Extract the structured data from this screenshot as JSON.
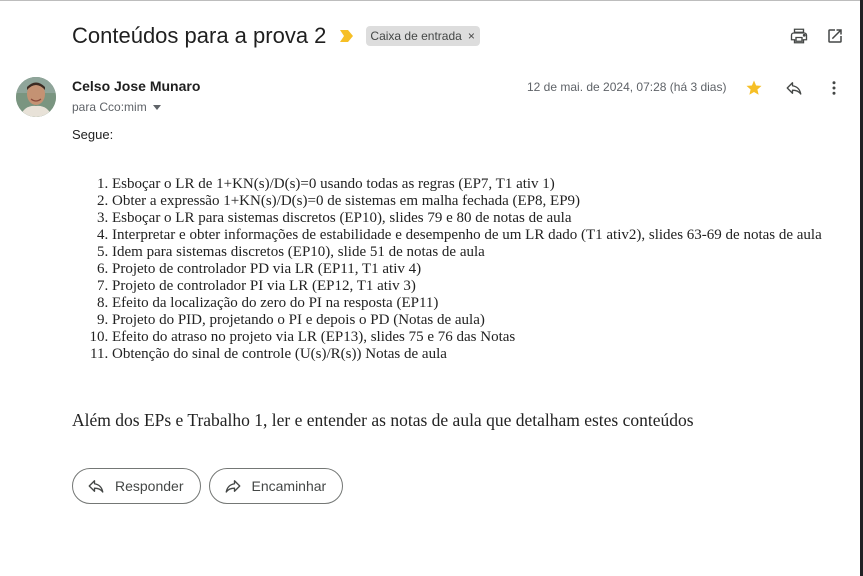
{
  "subject": "Conteúdos para a prova 2",
  "label": {
    "text": "Caixa de entrada",
    "remove": "×"
  },
  "toolbar": {
    "print_icon": "print-icon",
    "open_new_window_icon": "open-in-new-window-icon"
  },
  "sender": {
    "name": "Celso Jose Munaro",
    "recipient": "para Cco:mim",
    "date": "12 de mai. de 2024, 07:28 (há 3 dias)",
    "starred": true
  },
  "body": {
    "greeting": "Segue:",
    "items": [
      "Esboçar o LR de 1+KN(s)/D(s)=0 usando todas as regras (EP7, T1 ativ 1)",
      "Obter a expressão 1+KN(s)/D(s)=0  de sistemas em malha fechada (EP8, EP9)",
      "Esboçar o LR para sistemas discretos (EP10), slides 79 e 80 de notas de aula",
      "Interpretar e obter informações de estabilidade e desempenho de um LR dado (T1 ativ2), slides 63-69 de notas de aula",
      "Idem para sistemas discretos (EP10), slide 51 de notas de aula",
      "Projeto de controlador PD via LR (EP11, T1 ativ 4)",
      "Projeto de controlador PI via LR (EP12, T1 ativ 3)",
      "Efeito da localização do zero do PI na resposta (EP11)",
      "Projeto do PID,  projetando o PI e depois o PD (Notas de aula)",
      "Efeito do atraso no projeto via LR (EP13), slides 75 e 76 das Notas",
      "Obtenção do sinal de controle (U(s)/R(s)) Notas de aula"
    ],
    "closing": "Além dos EPs e Trabalho 1, ler e entender as notas de aula que detalham estes conteúdos"
  },
  "actions": {
    "reply": "Responder",
    "forward": "Encaminhar"
  },
  "colors": {
    "star": "#f6bf26",
    "important": "#f6bf26",
    "chip_bg": "#dddddd"
  }
}
